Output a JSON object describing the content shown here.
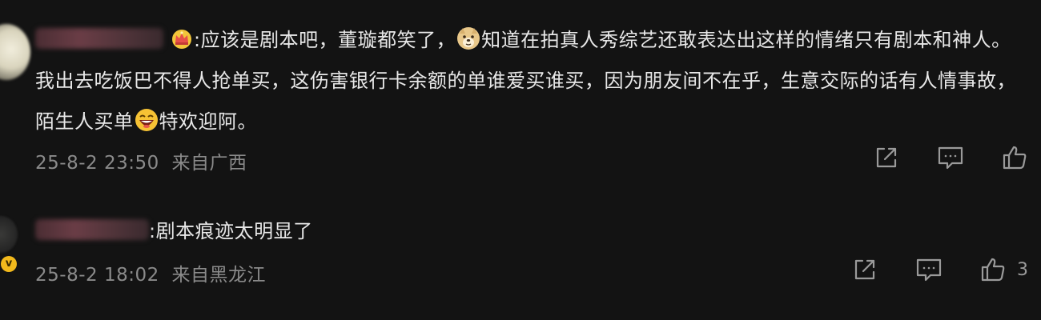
{
  "comments": [
    {
      "username": "",
      "text_pre": ":应该是剧本吧，董璇都笑了，",
      "text_mid": "知道在拍真人秀综艺还敢表达出这样的情绪只有剧本和神人。我出去吃饭巴不得人抢单买，这伤害银行卡余额的单谁爱买谁买，因为朋友间不在乎，生意交际的话有人情事故，陌生人买单",
      "text_post": "特欢迎阿。",
      "time": "25-8-2 23:50",
      "location": "来自广西",
      "icons": [
        "crown-icon",
        "doge-emoji",
        "laughing-emoji",
        "share-icon",
        "comment-icon",
        "like-icon"
      ]
    },
    {
      "username": "",
      "text": ":剧本痕迹太明显了",
      "time": "25-8-2 18:02",
      "location": "来自黑龙江",
      "verified_badge": "v",
      "like_count": "3",
      "icons": [
        "verified-badge-icon",
        "share-icon",
        "comment-icon",
        "like-icon"
      ]
    }
  ],
  "colors": {
    "background": "#131313",
    "text": "#e8e8e8",
    "meta": "#8a8a8a",
    "badge": "#f2b91c"
  }
}
